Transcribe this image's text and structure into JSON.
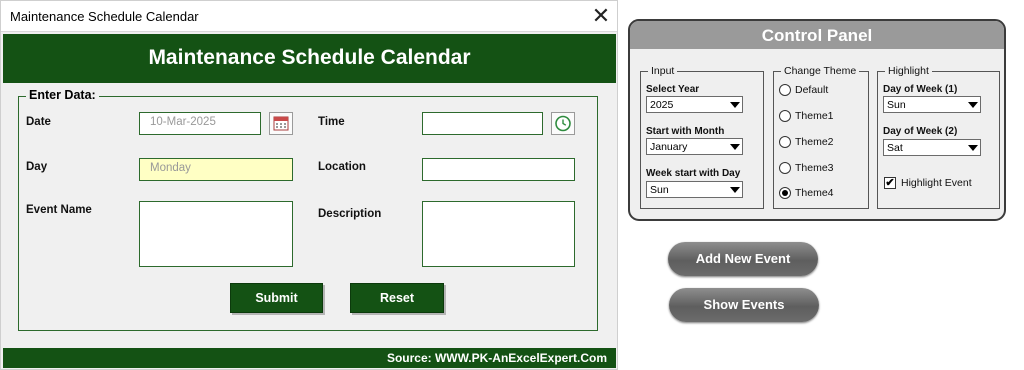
{
  "window": {
    "title": "Maintenance Schedule Calendar",
    "close_glyph": "✕"
  },
  "form": {
    "header_title": "Maintenance Schedule Calendar",
    "section_legend": "Enter Data:",
    "date_label": "Date",
    "date_value": "10-Mar-2025",
    "time_label": "Time",
    "time_value": "",
    "day_label": "Day",
    "day_value": "Monday",
    "location_label": "Location",
    "location_value": "",
    "event_name_label": "Event Name",
    "event_name_value": "",
    "description_label": "Description",
    "description_value": "",
    "submit_label": "Submit",
    "reset_label": "Reset",
    "footer_source": "Source: WWW.PK-AnExcelExpert.Com",
    "icons": [
      "calendar-icon",
      "clock-icon"
    ]
  },
  "control_panel": {
    "title": "Control Panel",
    "input": {
      "legend": "Input",
      "select_year_label": "Select Year",
      "select_year_value": "2025",
      "start_month_label": "Start with Month",
      "start_month_value": "January",
      "week_start_label": "Week start with Day",
      "week_start_value": "Sun"
    },
    "theme": {
      "legend": "Change Theme",
      "options": [
        "Default",
        "Theme1",
        "Theme2",
        "Theme3",
        "Theme4"
      ],
      "selected": "Theme4"
    },
    "highlight": {
      "legend": "Highlight",
      "dow1_label": "Day of Week (1)",
      "dow1_value": "Sun",
      "dow2_label": "Day of Week (2)",
      "dow2_value": "Sat",
      "highlight_event_label": "Highlight Event",
      "highlight_event_checked": true
    }
  },
  "actions": {
    "add_event_label": "Add New Event",
    "show_events_label": "Show Events"
  },
  "colors": {
    "dark_green": "#145214",
    "field_border": "#2d6a2d",
    "day_field_bg": "#ffffc4",
    "panel_header_gray": "#9a9a9a",
    "pill_gray": "#6c6c6c"
  }
}
